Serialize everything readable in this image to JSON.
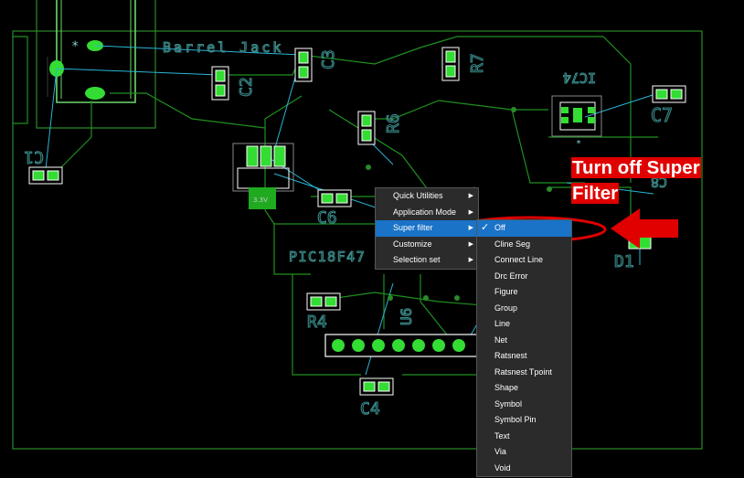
{
  "board_labels": {
    "barrel_jack": "Barrel Jack",
    "c1": "C1",
    "c2": "C2",
    "c3": "C3",
    "r7": "R7",
    "r6": "R6",
    "ic_top": "IC74",
    "c7": "C7",
    "c6": "C6",
    "vreg": "3.3V",
    "pic": "PIC18F47",
    "r4": "R4",
    "u6": "U6",
    "c4": "C4",
    "c8": "C8",
    "d1": "D1"
  },
  "context_menu": {
    "items": [
      {
        "label": "Quick Utilities",
        "has_submenu": true
      },
      {
        "label": "Application Mode",
        "has_submenu": true
      },
      {
        "label": "Super filter",
        "has_submenu": true,
        "active": true
      },
      {
        "label": "Customize",
        "has_submenu": true
      },
      {
        "label": "Selection set",
        "has_submenu": true
      }
    ]
  },
  "super_filter_submenu": {
    "checked_item": "Off",
    "items": [
      "Off",
      "Cline Seg",
      "Connect Line",
      "Drc Error",
      "Figure",
      "Group",
      "Line",
      "Net",
      "Ratsnest",
      "Ratsnest Tpoint",
      "Shape",
      "Symbol",
      "Symbol Pin",
      "Text",
      "Via",
      "Void"
    ]
  },
  "callout": {
    "line1": "Turn off Super",
    "line2": "Filter"
  },
  "colors": {
    "board_outline": "#2a8a2a",
    "trace": "#1f8f1f",
    "ratsnest": "#2ab5d6",
    "pad": "#33dd33",
    "highlight": "#e00000",
    "menu_bg": "#2b2b2b",
    "menu_active": "#1a73c7"
  }
}
